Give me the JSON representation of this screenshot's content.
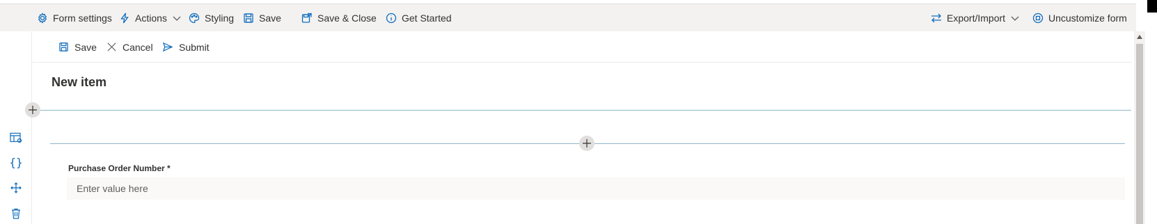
{
  "toolbar": {
    "form_settings": "Form settings",
    "actions": "Actions",
    "styling": "Styling",
    "save": "Save",
    "save_close": "Save & Close",
    "get_started": "Get Started",
    "export_import": "Export/Import",
    "uncustomize": "Uncustomize form"
  },
  "form_toolbar": {
    "save": "Save",
    "cancel": "Cancel",
    "submit": "Submit"
  },
  "form": {
    "title": "New item",
    "field_label": "Purchase Order Number *",
    "field_placeholder": "Enter value here",
    "field_value": ""
  },
  "colors": {
    "accent": "#0f6cbd",
    "toolbar_bg": "#f3f2f1",
    "divider": "#8fb8cc"
  }
}
